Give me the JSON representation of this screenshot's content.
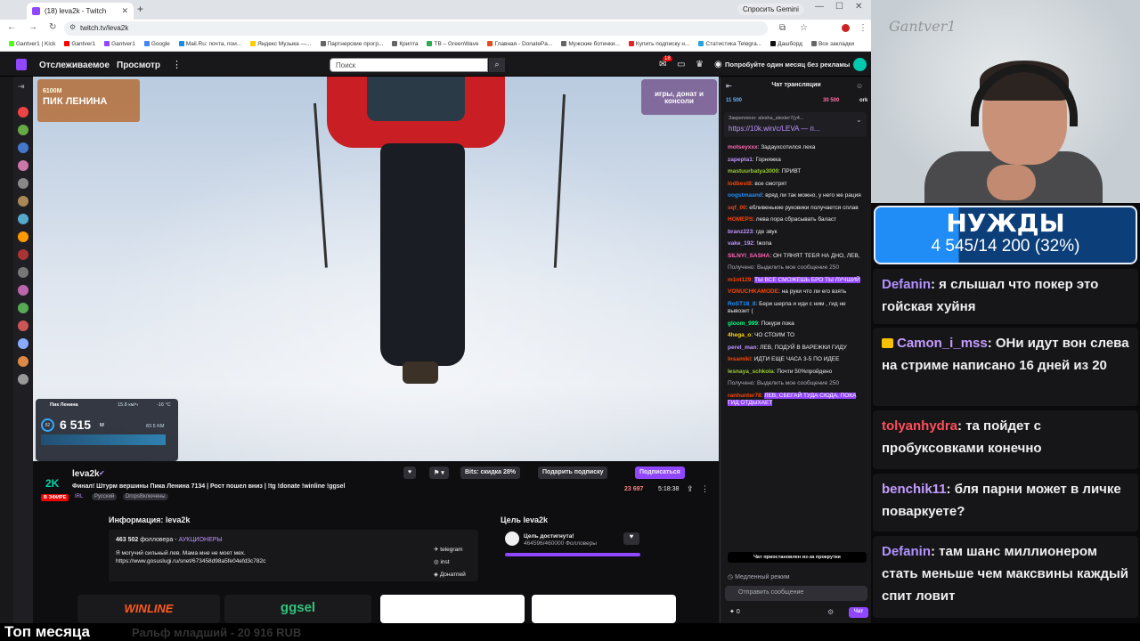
{
  "browser": {
    "tab_title": "(18) leva2k - Twitch",
    "new_tab": "+",
    "gemini": "Спросить Gemini",
    "url": "twitch.tv/leva2k",
    "bookmarks": [
      {
        "label": "Gantver1 | Kick",
        "color": "#53fc18"
      },
      {
        "label": "Gantver1",
        "color": "#ff0000"
      },
      {
        "label": "Gantver1",
        "color": "#9146ff"
      },
      {
        "label": "Google",
        "color": "#4285f4"
      },
      {
        "label": "Mail.Ru: почта, пои...",
        "color": "#168de2"
      },
      {
        "label": "Яндекс Музыка —...",
        "color": "#ffcc00"
      },
      {
        "label": "Партнерские прогр...",
        "color": "#666666"
      },
      {
        "label": "Крипта",
        "color": "#666666"
      },
      {
        "label": "TB – GreenWave",
        "color": "#2eaa4f"
      },
      {
        "label": "Главная - DonatePa...",
        "color": "#e84a1c"
      },
      {
        "label": "Мужские ботинки...",
        "color": "#666666"
      },
      {
        "label": "Купить подписку н...",
        "color": "#e22"
      },
      {
        "label": "Статистика Telegra...",
        "color": "#2aa3e0"
      },
      {
        "label": "Дашборд",
        "color": "#111111"
      },
      {
        "label": "Все закладки",
        "color": "#666666"
      }
    ]
  },
  "topnav": {
    "following": "Отслеживаемое",
    "browse": "Просмотр",
    "more": "⋮",
    "search_placeholder": "Поиск",
    "notif_count": "18",
    "promo": "Попробуйте один месяц без рекламы"
  },
  "video": {
    "overlay_small": "6100М",
    "overlay_title": "ПИК ЛЕНИНА",
    "ad_text": "игры, донат и консоли",
    "stats_title": "Пик Ленина",
    "stats_alt": "6 515",
    "stats_unit": "м",
    "stats_pct": "82",
    "stats_temp": "-16 °C",
    "stats_dist": "83.5 KM",
    "stats_speed": "15.8 км/ч"
  },
  "stream": {
    "logo": "2K",
    "live": "В ЭФИРЕ",
    "channel": "leva2k",
    "title": "Финал! Штурм вершины Пика Ленина 7134 | Рост пошел вниз | !tg !donate !winline !ggsel",
    "tag_irl": "IRL",
    "tag_ru": "Русский",
    "tag_drops": "DropsВключены",
    "bits_label": "Bits: скидка 28%",
    "gift_label": "Подарить подписку",
    "subscribe_label": "Подписаться",
    "viewers": "23 697",
    "uptime": "5:18:38"
  },
  "about": {
    "header": "Информация: leva2k",
    "followers": "463 502",
    "followers_label": "фолловера",
    "team": "АУКЦИОНЕРЫ",
    "bio_line1": "Я могучий сильный лев. Мама мне не моет мех.",
    "bio_line2": "https://www.gosuslugi.ru/snet/673458d98a5fe04efd3c782c",
    "links": [
      "telegram",
      "inst",
      "Донатпей"
    ]
  },
  "goal": {
    "header": "Цель leva2k",
    "done": "Цель достигнута!",
    "progress": "464596/460000 Фолловеры",
    "fraction": 1.0
  },
  "sponsors": {
    "winline": "WINLINE",
    "ggsel": "ggsel"
  },
  "chat": {
    "header": "Чат трансляции",
    "pred_left": "11 500",
    "pred_right": "30 500",
    "pred_ork": "ork",
    "pinned_by": "Закреплено: alesha_alexter7(у4...",
    "pinned_link": "https://10k.win/c/LEVA — п...",
    "messages": [
      {
        "user": "motseyxxx",
        "color": "#ff69b4",
        "text": "Задаухсотился леха",
        "sys": false
      },
      {
        "user": "zapepta1",
        "color": "#bf94ff",
        "text": "Горняжка",
        "sys": false
      },
      {
        "user": "mastuurbatya3000",
        "color": "#9acd32",
        "text": "ПРИВТ",
        "sys": false
      },
      {
        "user": "lodbest8",
        "color": "#ff4500",
        "text": "все смотрят",
        "sys": false
      },
      {
        "user": "oogstmaand",
        "color": "#1e90ff",
        "text": "вряд ли так можно, у него же рация",
        "sys": false
      },
      {
        "user": "sqf_00",
        "color": "#ff4500",
        "text": "ебливенькие руковики получается сплав",
        "sys": false
      },
      {
        "user": "HOMEPS",
        "color": "#ff4500",
        "text": "лева пора сбрасывать баласт",
        "sys": false
      },
      {
        "user": "branz223",
        "color": "#bf94ff",
        "text": "где звук",
        "sys": false
      },
      {
        "user": "vake_192",
        "color": "#bf94ff",
        "text": "!жопа",
        "sys": false
      },
      {
        "user": "SILNYI_SASHA",
        "color": "#ff69b4",
        "text": "ОН ТЯНЯТ ТЕБЯ НА ДНО, ЛЕВ,",
        "sys": false
      },
      {
        "user": "",
        "color": "#adadb8",
        "text": "Получено: Выделить мое сообщение 250",
        "sys": true
      },
      {
        "user": "m1nt129",
        "color": "#ff4500",
        "text": "ТЫ ВСЕ СМОЖЕШЬ БРО ТЫ ЛУЧШИЙ",
        "sys": false,
        "hl": true
      },
      {
        "user": "VONUCHKAMODE",
        "color": "#ff4500",
        "text": "на руки что ли его взять",
        "sys": false
      },
      {
        "user": "RoST18_8",
        "color": "#1e90ff",
        "text": "Бери шерпа и иди с ним , гид не вывозит (",
        "sys": false
      },
      {
        "user": "gloom_999",
        "color": "#00ff7f",
        "text": "Покури пока",
        "sys": false
      },
      {
        "user": "4hega_o",
        "color": "#ffd700",
        "text": "ЧО СТОИМ ТО",
        "sys": false
      },
      {
        "user": "perel_man",
        "color": "#bf94ff",
        "text": "ЛЕВ, ПОДУЙ В ВАРЕЖКИ ГИДУ",
        "sys": false
      },
      {
        "user": "lnsamiki",
        "color": "#ff4500",
        "text": "ИДТИ ЕЩЕ ЧАСА 3-5 ПО ИДЕЕ",
        "sys": false
      },
      {
        "user": "lesnaya_schkola",
        "color": "#9acd32",
        "text": "Почти 50%пройдено",
        "sys": false
      },
      {
        "user": "",
        "color": "#adadb8",
        "text": "Получено: Выделить мое сообщение 250",
        "sys": true
      },
      {
        "user": "ranhunter78",
        "color": "#ff4500",
        "text": "ЛЕВ, СБЕГАЙ ТУДА СЮДА, ПОКА ГИД ОТДЫХАЕТ",
        "sys": false,
        "hl": true
      }
    ],
    "paused": "Чат приостановлен из-за прокрутки",
    "slow": "Медленный режим",
    "input_placeholder": "Отправить сообщение",
    "points": "0",
    "send": "Чат"
  },
  "overlay": {
    "cam_watermark": "Gantver1",
    "needs_title": "НУЖДЫ",
    "needs_progress": "4 545/14 200 (32%)",
    "needs_fraction": 0.32,
    "messages": [
      {
        "user": "Defanin",
        "text": ": я слышал что покер это гойская хуйня",
        "cls": "u1",
        "badge": false
      },
      {
        "user": "Camon_i_mss",
        "text": ": ОНи идут вон слева на стриме написано 16 дней из 20",
        "cls": "u2",
        "badge": true
      },
      {
        "user": "tolyanhydra",
        "text": ": та пойдет с пробуксовками конечно",
        "cls": "u3",
        "badge": false
      },
      {
        "user": "benchik11",
        "text": ": бля парни может в личке поваркуете?",
        "cls": "u2",
        "badge": false
      },
      {
        "user": "Defanin",
        "text": ": там шанс миллионером стать меньше чем максвины каждый спит ловит",
        "cls": "u4",
        "badge": false
      }
    ]
  },
  "ticker": {
    "label": "Топ месяца",
    "entry": "Ральф младший - 20 916 RUB"
  }
}
